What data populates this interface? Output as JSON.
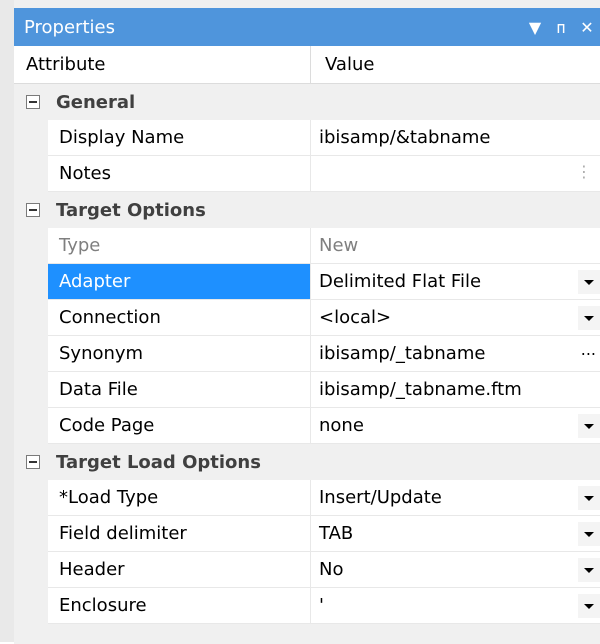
{
  "panel": {
    "title": "Properties",
    "icons": [
      "chevron-down-icon",
      "pin-icon",
      "close-icon"
    ],
    "glyphs": {
      "chevron": "▼",
      "pin": "ᴨ",
      "close": "✕"
    }
  },
  "columns": {
    "attribute": "Attribute",
    "value": "Value"
  },
  "general": {
    "label": "General",
    "display_name": {
      "name": "Display Name",
      "value": "ibisamp/&tabname"
    },
    "notes": {
      "name": "Notes",
      "value": "",
      "more": "⋮"
    }
  },
  "target_options": {
    "label": "Target Options",
    "type": {
      "name": "Type",
      "value": "New"
    },
    "adapter": {
      "name": "Adapter",
      "value": "Delimited Flat File"
    },
    "connection": {
      "name": "Connection",
      "value": "<local>"
    },
    "synonym": {
      "name": "Synonym",
      "value": "ibisamp/_tabname",
      "browse": "..."
    },
    "data_file": {
      "name": "Data File",
      "value": "ibisamp/_tabname.ftm"
    },
    "code_page": {
      "name": "Code Page",
      "value": "none"
    }
  },
  "target_load_options": {
    "label": "Target Load Options",
    "load_type": {
      "name": "*Load Type",
      "value": "Insert/Update"
    },
    "field_delimiter": {
      "name": "Field delimiter",
      "value": "TAB"
    },
    "header": {
      "name": "Header",
      "value": "No"
    },
    "enclosure": {
      "name": "Enclosure",
      "value": "'"
    }
  },
  "colors": {
    "titlebar": "#4f95dc",
    "selected": "#1e90ff",
    "category_bg": "#f0f0f0"
  }
}
